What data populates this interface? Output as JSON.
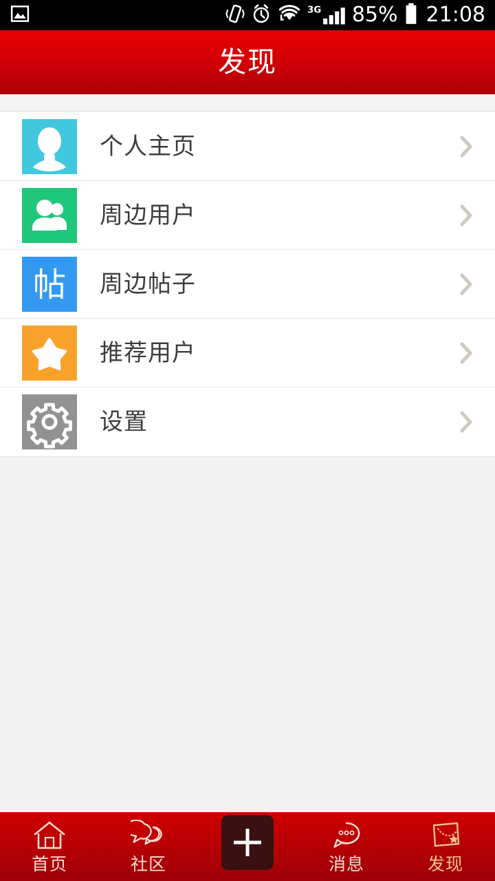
{
  "statusbar": {
    "left_icons": [
      "image-icon"
    ],
    "right_icons": [
      "vibrate-icon",
      "alarm-icon",
      "wifi-icon",
      "signal-icon"
    ],
    "network_label": "3G",
    "battery_label": "85%",
    "time": "21:08"
  },
  "header": {
    "title": "发现",
    "background_color": "#d30006"
  },
  "list": {
    "items": [
      {
        "label": "个人主页",
        "icon": "person-icon",
        "icon_color": "#42c8de",
        "chevron": "chevron-right-icon"
      },
      {
        "label": "周边用户",
        "icon": "people-icon",
        "icon_color": "#1fc77a",
        "chevron": "chevron-right-icon"
      },
      {
        "label": "周边帖子",
        "icon": "post-icon",
        "icon_color": "#3399f0",
        "icon_glyph": "帖",
        "chevron": "chevron-right-icon"
      },
      {
        "label": "推荐用户",
        "icon": "star-icon",
        "icon_color": "#f9a22b",
        "chevron": "chevron-right-icon"
      },
      {
        "label": "设置",
        "icon": "gear-icon",
        "icon_color": "#949192",
        "chevron": "chevron-right-icon"
      }
    ]
  },
  "tabbar": {
    "background_color": "#bb0004",
    "active_color": "#f3c18d",
    "inactive_color": "#f7dcd4",
    "items": [
      {
        "label": "首页",
        "icon": "home-icon",
        "active": false
      },
      {
        "label": "社区",
        "icon": "community-bubbles-icon",
        "active": false
      },
      {
        "label": "",
        "icon": "plus-icon",
        "center": true,
        "active": false
      },
      {
        "label": "消息",
        "icon": "message-bubble-icon",
        "active": false
      },
      {
        "label": "发现",
        "icon": "discover-map-icon",
        "active": true
      }
    ]
  }
}
